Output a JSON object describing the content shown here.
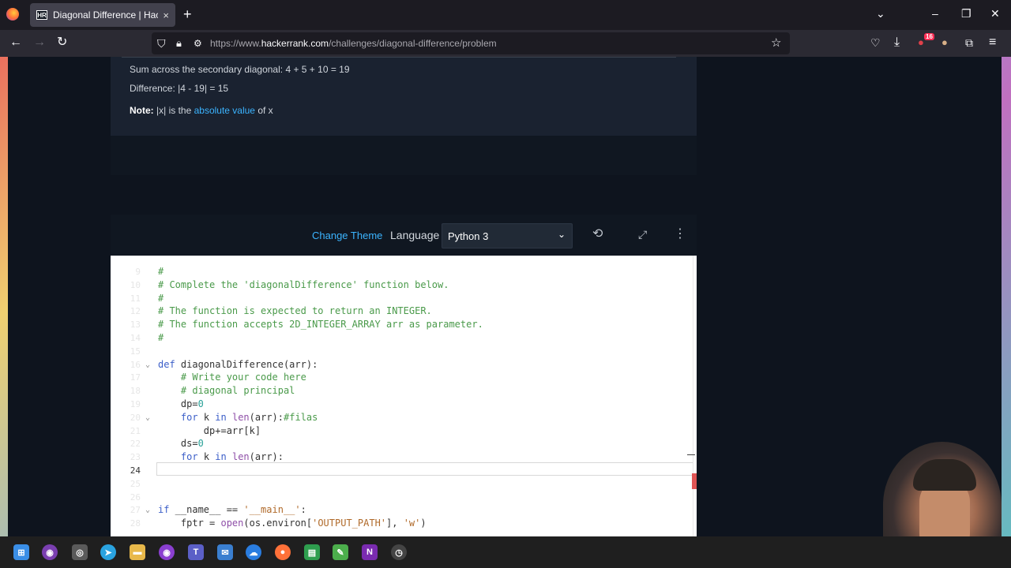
{
  "browser": {
    "tab_title": "Diagonal Difference | HackerRank",
    "tab_favicon": "HR",
    "tab_close": "×",
    "new_tab": "+",
    "url_prefix": "https://www.",
    "url_domain": "hackerrank.com",
    "url_path": "/challenges/diagonal-difference/problem",
    "extension_badge": "16"
  },
  "problem": {
    "sum_secondary": "Sum across the secondary diagonal: 4 + 5 + 10 = 19",
    "difference": "Difference: |4 - 19| = 15",
    "note_label": "Note:",
    "note_text_1": " |x| is the ",
    "note_link": "absolute value",
    "note_text_2": " of x"
  },
  "toolbar": {
    "change_theme": "Change Theme",
    "language_label": "Language",
    "language_value": "Python 3"
  },
  "editor": {
    "active_line_number": "24",
    "lines": [
      {
        "n": "9",
        "t": "#"
      },
      {
        "n": "10",
        "t": "# Complete the 'diagonalDifference' function below."
      },
      {
        "n": "11",
        "t": "#"
      },
      {
        "n": "12",
        "t": "# The function is expected to return an INTEGER."
      },
      {
        "n": "13",
        "t": "# The function accepts 2D_INTEGER_ARRAY arr as parameter."
      },
      {
        "n": "14",
        "t": "#"
      },
      {
        "n": "15",
        "t": ""
      },
      {
        "n": "16",
        "t": "def diagonalDifference(arr):"
      },
      {
        "n": "17",
        "t": "    # Write your code here"
      },
      {
        "n": "18",
        "t": "    # diagonal principal"
      },
      {
        "n": "19",
        "t": "    dp=0"
      },
      {
        "n": "20",
        "t": "    for k in len(arr):#filas"
      },
      {
        "n": "21",
        "t": "        dp+=arr[k]"
      },
      {
        "n": "22",
        "t": "    ds=0"
      },
      {
        "n": "23",
        "t": "    for k in len(arr):"
      },
      {
        "n": "24",
        "t": ""
      },
      {
        "n": "25",
        "t": ""
      },
      {
        "n": "26",
        "t": ""
      },
      {
        "n": "27",
        "t": "if __name__ == '__main__':"
      },
      {
        "n": "28",
        "t": "    fptr = open(os.environ['OUTPUT_PATH'], 'w')"
      }
    ]
  },
  "icons": {
    "back": "arrow-left-icon",
    "forward": "arrow-right-icon",
    "reload": "reload-icon",
    "shield": "shield-icon",
    "lock": "lock-icon",
    "bookmark": "star-icon",
    "history": "history-icon",
    "fullscreen": "expand-icon",
    "more": "kebab-menu-icon"
  },
  "colors": {
    "accent_link": "#3bb4ff",
    "page_bg": "#0e141e",
    "comment": "#4a9a4a",
    "keyword": "#3b5ec8"
  }
}
